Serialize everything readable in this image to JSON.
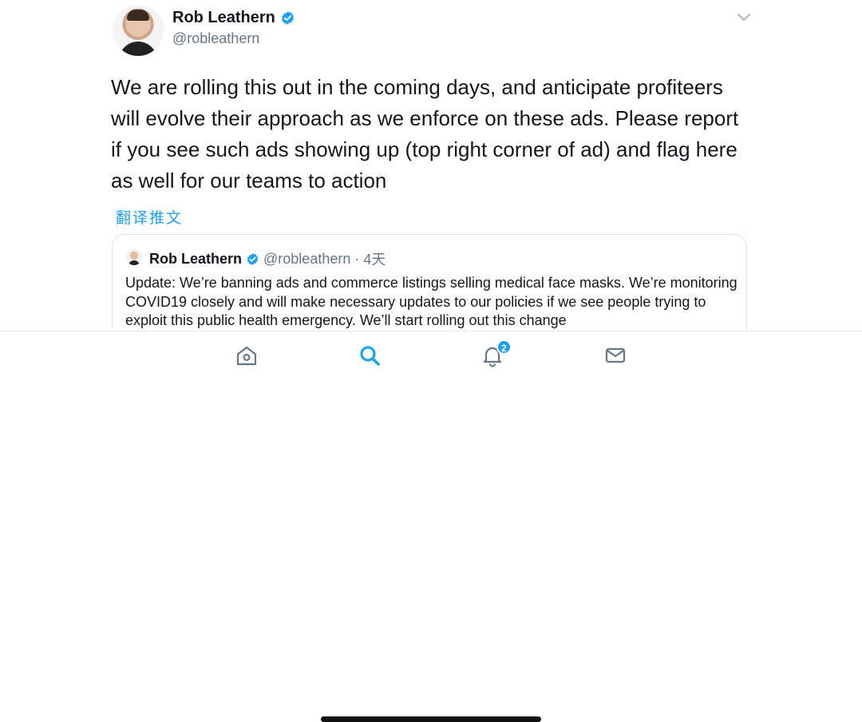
{
  "tweet": {
    "author": {
      "name": "Rob Leathern",
      "handle": "@robleathern",
      "verified": true
    },
    "text": "We are rolling this out in the coming days, and anticipate profiteers will evolve their approach as we enforce on these ads. Please report if you see such ads showing up (top right corner of ad) and flag here as well for our teams to action",
    "translate_label": "翻译推文",
    "menu_icon": "chevron-down-icon"
  },
  "quoted_tweet": {
    "author": {
      "name": "Rob Leathern",
      "handle": "@robleathern",
      "verified": true
    },
    "separator": "·",
    "time": "4天",
    "text": "Update: We’re banning ads and commerce listings selling medical face masks. We’re monitoring COVID19 closely and will make necessary updates to our policies if we see people trying to exploit this public health emergency. We’ll start rolling out this change"
  },
  "tab_bar": {
    "tabs": [
      {
        "name": "home",
        "icon": "home-icon",
        "active": false
      },
      {
        "name": "search",
        "icon": "search-icon",
        "active": true
      },
      {
        "name": "notifications",
        "icon": "bell-icon",
        "active": false,
        "badge": "2"
      },
      {
        "name": "messages",
        "icon": "mail-icon",
        "active": false
      }
    ]
  },
  "colors": {
    "accent": "#1da1f2",
    "text_primary": "#14171a",
    "text_secondary": "#657786",
    "border": "#dfe3e7",
    "icon_inactive": "#657786"
  }
}
